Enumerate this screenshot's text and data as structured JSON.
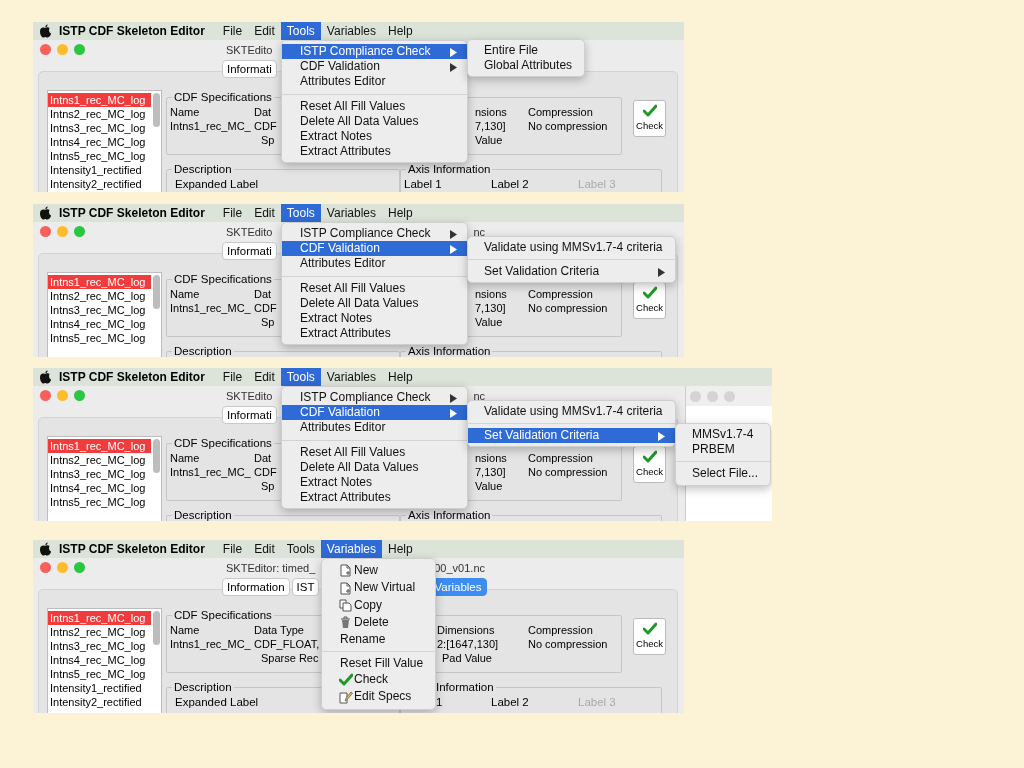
{
  "panels": [
    {
      "menubar": {
        "app": "ISTP CDF Skeleton Editor",
        "items": [
          {
            "label": "File",
            "selected": false
          },
          {
            "label": "Edit",
            "selected": false
          },
          {
            "label": "Tools",
            "selected": true
          },
          {
            "label": "Variables",
            "selected": false
          },
          {
            "label": "Help",
            "selected": false
          }
        ]
      },
      "window": {
        "title_parts": [
          "SKTEdito"
        ],
        "tabs": [
          {
            "label": "Informati",
            "selected": false
          }
        ],
        "variables": [
          {
            "label": "Intns1_rec_MC_log",
            "selected": true
          },
          {
            "label": "Intns2_rec_MC_log",
            "selected": false
          },
          {
            "label": "Intns3_rec_MC_log",
            "selected": false
          },
          {
            "label": "Intns4_rec_MC_log",
            "selected": false
          },
          {
            "label": "Intns5_rec_MC_log",
            "selected": false
          },
          {
            "label": "Intensity1_rectified",
            "selected": false
          },
          {
            "label": "Intensity2_rectified",
            "selected": false
          }
        ],
        "specs": {
          "title": "CDF Specifications",
          "columns": [
            [
              "Name",
              "Intns1_rec_MC_"
            ],
            [
              "Dat",
              "CDF",
              "Sp"
            ],
            [
              "nsions",
              "7,130]",
              "Value"
            ],
            [
              "Compression",
              "No compression"
            ]
          ]
        },
        "check_button": "Check",
        "description": {
          "title": "Description",
          "label": "Expanded Label"
        },
        "axis": {
          "title": "Axis Information",
          "labels": [
            {
              "label": "Label 1",
              "disabled": false
            },
            {
              "label": "Label 2",
              "disabled": false
            },
            {
              "label": "Label 3",
              "disabled": true
            }
          ]
        }
      },
      "menu": {
        "items": [
          {
            "kind": "item",
            "label": "ISTP Compliance Check",
            "selected": true,
            "arrow": true,
            "submenu": {
              "items": [
                {
                  "kind": "item",
                  "label": "Entire File",
                  "selected": false
                },
                {
                  "kind": "item",
                  "label": "Global Attributes",
                  "selected": false
                }
              ]
            }
          },
          {
            "kind": "item",
            "label": "CDF Validation",
            "selected": false,
            "arrow": true
          },
          {
            "kind": "item",
            "label": "Attributes Editor",
            "selected": false
          },
          {
            "kind": "separator"
          },
          {
            "kind": "item",
            "label": "Reset All Fill Values",
            "selected": false
          },
          {
            "kind": "item",
            "label": "Delete All Data Values",
            "selected": false
          },
          {
            "kind": "item",
            "label": "Extract Notes",
            "selected": false
          },
          {
            "kind": "item",
            "label": "Extract Attributes",
            "selected": false
          }
        ]
      }
    },
    {
      "menubar": {
        "app": "ISTP CDF Skeleton Editor",
        "items": [
          {
            "label": "File",
            "selected": false
          },
          {
            "label": "Edit",
            "selected": false
          },
          {
            "label": "Tools",
            "selected": true
          },
          {
            "label": "Variables",
            "selected": false
          },
          {
            "label": "Help",
            "selected": false
          }
        ]
      },
      "window": {
        "title_parts": [
          "SKTEdito",
          "nc"
        ],
        "tabs": [
          {
            "label": "Informati",
            "selected": false
          }
        ],
        "variables": [
          {
            "label": "Intns1_rec_MC_log",
            "selected": true
          },
          {
            "label": "Intns2_rec_MC_log",
            "selected": false
          },
          {
            "label": "Intns3_rec_MC_log",
            "selected": false
          },
          {
            "label": "Intns4_rec_MC_log",
            "selected": false
          },
          {
            "label": "Intns5_rec_MC_log",
            "selected": false
          }
        ],
        "specs": {
          "title": "CDF Specifications",
          "columns": [
            [
              "Name",
              "Intns1_rec_MC_"
            ],
            [
              "Dat",
              "CDF",
              "Sp"
            ],
            [
              "nsions",
              "7,130]",
              "Value"
            ],
            [
              "Compression",
              "No compression"
            ]
          ]
        },
        "check_button": "Check",
        "description": {
          "title": "Description"
        },
        "axis": {
          "title": "Axis Information"
        }
      },
      "menu": {
        "items": [
          {
            "kind": "item",
            "label": "ISTP Compliance Check",
            "selected": false,
            "arrow": true
          },
          {
            "kind": "item",
            "label": "CDF Validation",
            "selected": true,
            "arrow": true,
            "submenu": {
              "items": [
                {
                  "kind": "item",
                  "label": "Validate using MMSv1.7-4 criteria",
                  "selected": false
                },
                {
                  "kind": "separator"
                },
                {
                  "kind": "item",
                  "label": "Set Validation Criteria",
                  "selected": false,
                  "arrow": true
                }
              ]
            }
          },
          {
            "kind": "item",
            "label": "Attributes Editor",
            "selected": false
          },
          {
            "kind": "separator"
          },
          {
            "kind": "item",
            "label": "Reset All Fill Values",
            "selected": false
          },
          {
            "kind": "item",
            "label": "Delete All Data Values",
            "selected": false
          },
          {
            "kind": "item",
            "label": "Extract Notes",
            "selected": false
          },
          {
            "kind": "item",
            "label": "Extract Attributes",
            "selected": false
          }
        ]
      }
    },
    {
      "menubar": {
        "app": "ISTP CDF Skeleton Editor",
        "items": [
          {
            "label": "File",
            "selected": false
          },
          {
            "label": "Edit",
            "selected": false
          },
          {
            "label": "Tools",
            "selected": true
          },
          {
            "label": "Variables",
            "selected": false
          },
          {
            "label": "Help",
            "selected": false
          }
        ]
      },
      "window": {
        "title_parts": [
          "SKTEdito",
          "nc"
        ],
        "tabs": [
          {
            "label": "Informati",
            "selected": false
          }
        ],
        "variables": [
          {
            "label": "Intns1_rec_MC_log",
            "selected": true
          },
          {
            "label": "Intns2_rec_MC_log",
            "selected": false
          },
          {
            "label": "Intns3_rec_MC_log",
            "selected": false
          },
          {
            "label": "Intns4_rec_MC_log",
            "selected": false
          },
          {
            "label": "Intns5_rec_MC_log",
            "selected": false
          }
        ],
        "specs": {
          "title": "CDF Specifications",
          "columns": [
            [
              "Name",
              "Intns1_rec_MC_"
            ],
            [
              "Dat",
              "CDF",
              "Sp"
            ],
            [
              "nsions",
              "7,130]",
              "Value"
            ],
            [
              "Compression",
              "No compression"
            ]
          ]
        },
        "check_button": "Check",
        "description": {
          "title": "Description"
        },
        "axis": {
          "title": "Axis Information"
        }
      },
      "side_window": {
        "active": false
      },
      "menu": {
        "items": [
          {
            "kind": "item",
            "label": "ISTP Compliance Check",
            "selected": false,
            "arrow": true
          },
          {
            "kind": "item",
            "label": "CDF Validation",
            "selected": true,
            "arrow": true,
            "submenu": {
              "items": [
                {
                  "kind": "item",
                  "label": "Validate using MMSv1.7-4 criteria",
                  "selected": false
                },
                {
                  "kind": "separator"
                },
                {
                  "kind": "item",
                  "label": "Set Validation Criteria",
                  "selected": true,
                  "arrow": true,
                  "submenu": {
                    "items": [
                      {
                        "kind": "item",
                        "label": "MMSv1.7-4",
                        "selected": false
                      },
                      {
                        "kind": "item",
                        "label": "PRBEM",
                        "selected": false
                      },
                      {
                        "kind": "separator"
                      },
                      {
                        "kind": "item",
                        "label": "Select File...",
                        "selected": false
                      }
                    ]
                  }
                }
              ]
            }
          },
          {
            "kind": "item",
            "label": "Attributes Editor",
            "selected": false
          },
          {
            "kind": "separator"
          },
          {
            "kind": "item",
            "label": "Reset All Fill Values",
            "selected": false
          },
          {
            "kind": "item",
            "label": "Delete All Data Values",
            "selected": false
          },
          {
            "kind": "item",
            "label": "Extract Notes",
            "selected": false
          },
          {
            "kind": "item",
            "label": "Extract Attributes",
            "selected": false
          }
        ]
      }
    },
    {
      "menubar": {
        "app": "ISTP CDF Skeleton Editor",
        "items": [
          {
            "label": "File",
            "selected": false
          },
          {
            "label": "Edit",
            "selected": false
          },
          {
            "label": "Tools",
            "selected": false
          },
          {
            "label": "Variables",
            "selected": true
          },
          {
            "label": "Help",
            "selected": false
          }
        ]
      },
      "window": {
        "title_parts": [
          "SKTEditor: timed_",
          "00_v01.nc"
        ],
        "tabs": [
          {
            "label": "Information",
            "selected": false
          },
          {
            "label": "IST",
            "selected": false
          },
          {
            "label": "Variables",
            "selected": true
          }
        ],
        "variables": [
          {
            "label": "Intns1_rec_MC_log",
            "selected": true
          },
          {
            "label": "Intns2_rec_MC_log",
            "selected": false
          },
          {
            "label": "Intns3_rec_MC_log",
            "selected": false
          },
          {
            "label": "Intns4_rec_MC_log",
            "selected": false
          },
          {
            "label": "Intns5_rec_MC_log",
            "selected": false
          },
          {
            "label": "Intensity1_rectified",
            "selected": false
          },
          {
            "label": "Intensity2_rectified",
            "selected": false
          }
        ],
        "specs": {
          "title": "CDF Specifications",
          "columns": [
            [
              "Name",
              "Intns1_rec_MC_"
            ],
            [
              "Data Type",
              "CDF_FLOAT,",
              "Sparse Rec"
            ],
            [
              "Dimensions",
              "2:[1647,130]",
              "Pad Value"
            ],
            [
              "Compression",
              "No compression"
            ]
          ]
        },
        "check_button": "Check",
        "description": {
          "title": "Description",
          "label": "Expanded Label"
        },
        "axis": {
          "title": "Information",
          "labels": [
            {
              "label": "1",
              "disabled": false
            },
            {
              "label": "Label 2",
              "disabled": false
            },
            {
              "label": "Label 3",
              "disabled": true
            }
          ]
        }
      },
      "menu": {
        "items": [
          {
            "kind": "new",
            "label": "New",
            "selected": false
          },
          {
            "kind": "new",
            "label": "New Virtual",
            "selected": false
          },
          {
            "kind": "copy",
            "label": "Copy",
            "selected": false
          },
          {
            "kind": "delete",
            "label": "Delete",
            "selected": false
          },
          {
            "kind": "item",
            "label": "Rename",
            "selected": false
          },
          {
            "kind": "separator"
          },
          {
            "kind": "item",
            "label": "Reset Fill Value",
            "selected": false
          },
          {
            "kind": "check",
            "label": "Check",
            "selected": false
          },
          {
            "kind": "edit",
            "label": "Edit Specs",
            "selected": false
          }
        ]
      }
    }
  ]
}
